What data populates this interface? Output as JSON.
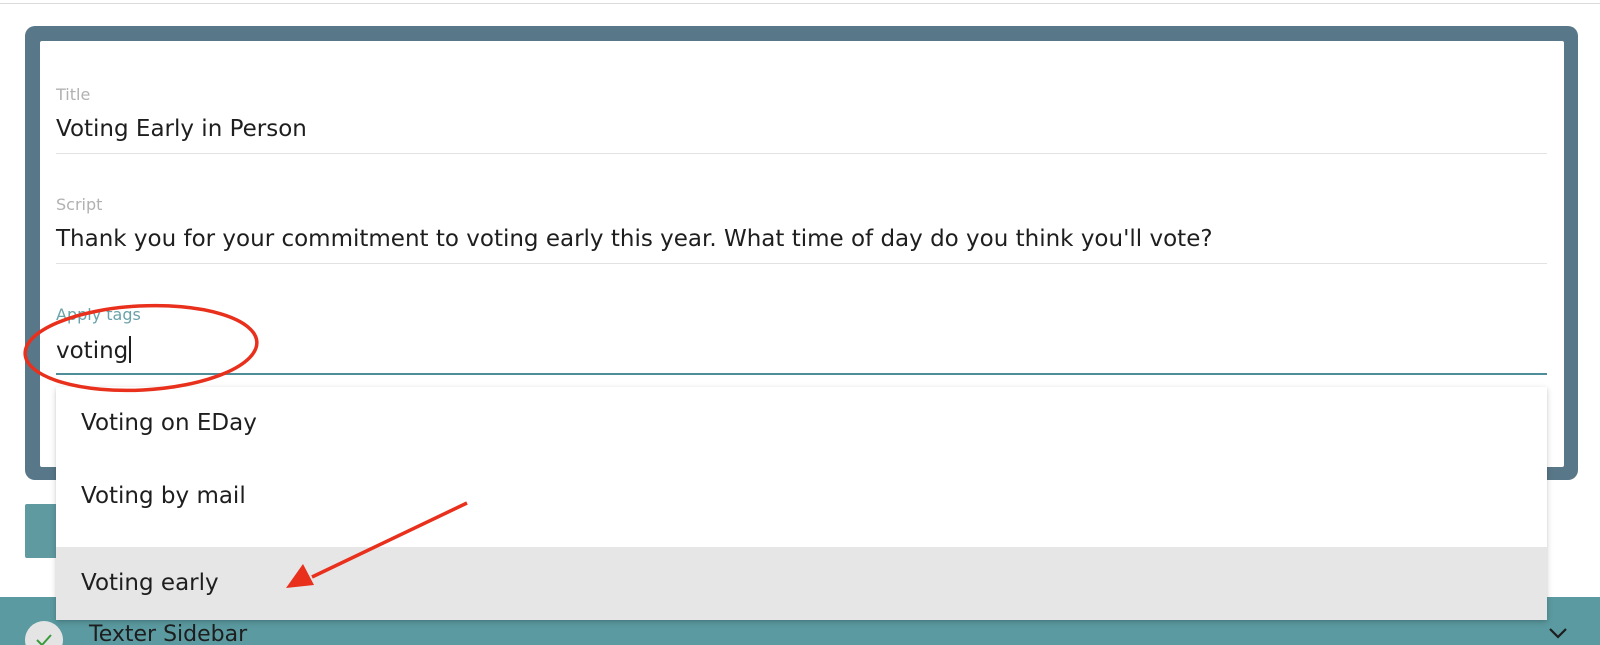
{
  "form": {
    "title_label": "Title",
    "title_value": "Voting Early in Person",
    "script_label": "Script",
    "script_value": "Thank you for your commitment to voting early this year. What time of day do you think you'll vote?",
    "tags_label": "Apply tags",
    "tags_value": "voting"
  },
  "dropdown": {
    "options": [
      {
        "label": "Voting on EDay"
      },
      {
        "label": "Voting by mail"
      },
      {
        "label": "Voting early"
      }
    ],
    "highlighted_option": "Voting early"
  },
  "sidebar": {
    "title": "Texter Sidebar",
    "status_icon": "check-icon",
    "toggle_icon": "chevron-down-icon"
  },
  "colors": {
    "card_frame": "#587788",
    "accent": "#4f8e99",
    "sidebar_bar": "#5a9aa0",
    "annotation": "#e8301c"
  }
}
